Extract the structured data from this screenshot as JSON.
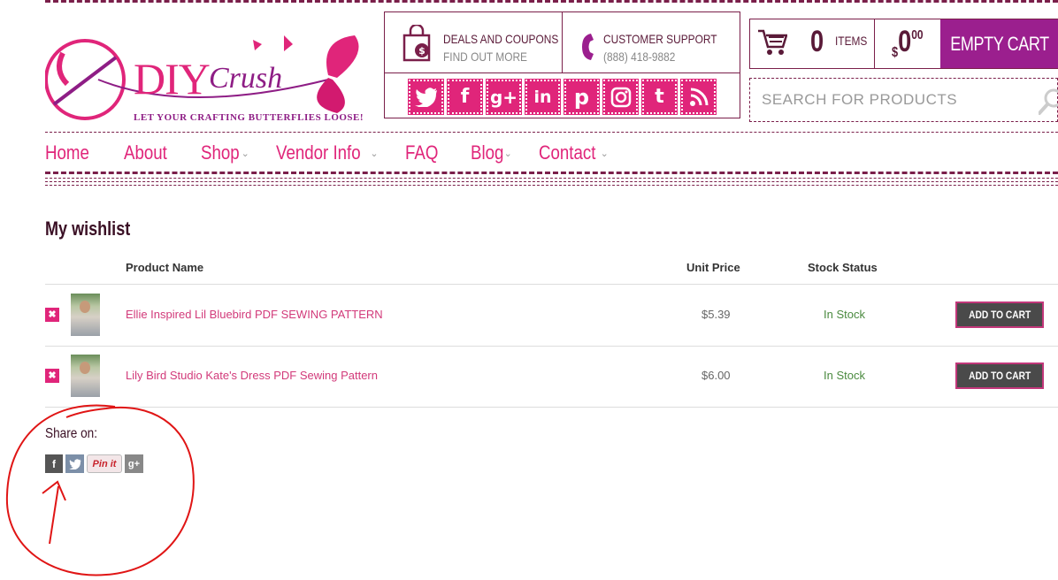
{
  "brand": {
    "name_primary": "DIY",
    "name_script": "Crush",
    "tagline": "LET YOUR CRAFTING BUTTERFLIES LOOSE!"
  },
  "header": {
    "deals_title": "DEALS AND COUPONS",
    "deals_sub": "FIND OUT MORE",
    "support_title": "CUSTOMER SUPPORT",
    "support_phone": "(888) 418-9882",
    "social": [
      "twitter-icon",
      "facebook-icon",
      "google-plus-icon",
      "linkedin-icon",
      "pinterest-icon",
      "instagram-icon",
      "tumblr-icon",
      "rss-icon"
    ]
  },
  "cart": {
    "count": "0",
    "items_label": "ITEMS",
    "currency": "$",
    "total_whole": "0",
    "total_cents": "00",
    "empty_label": "EMPTY CART"
  },
  "search": {
    "placeholder": "SEARCH FOR PRODUCTS"
  },
  "nav": [
    {
      "label": "Home"
    },
    {
      "label": "About"
    },
    {
      "label": "Shop"
    },
    {
      "label": "Vendor Info"
    },
    {
      "label": "FAQ"
    },
    {
      "label": "Blog"
    },
    {
      "label": "Contact"
    }
  ],
  "wishlist": {
    "title": "My wishlist",
    "columns": {
      "product_name": "Product Name",
      "unit_price": "Unit Price",
      "stock_status": "Stock Status"
    },
    "rows": [
      {
        "name": "Ellie Inspired Lil Bluebird PDF SEWING PATTERN",
        "price": "$5.39",
        "stock": "In Stock",
        "action": "ADD TO CART"
      },
      {
        "name": "Lily Bird Studio Kate's Dress PDF Sewing Pattern",
        "price": "$6.00",
        "stock": "In Stock",
        "action": "ADD TO CART"
      }
    ]
  },
  "share": {
    "title": "Share on:",
    "pinterest_label": "Pin it",
    "buttons": [
      "facebook-icon",
      "twitter-icon",
      "pinterest-icon",
      "google-plus-icon"
    ]
  },
  "colors": {
    "brand_pink": "#e0257a",
    "brand_purple": "#9b1f8e",
    "dark_plum": "#7a1f4a",
    "in_stock_green": "#4a8a3f",
    "annotation_red": "#e01515"
  }
}
